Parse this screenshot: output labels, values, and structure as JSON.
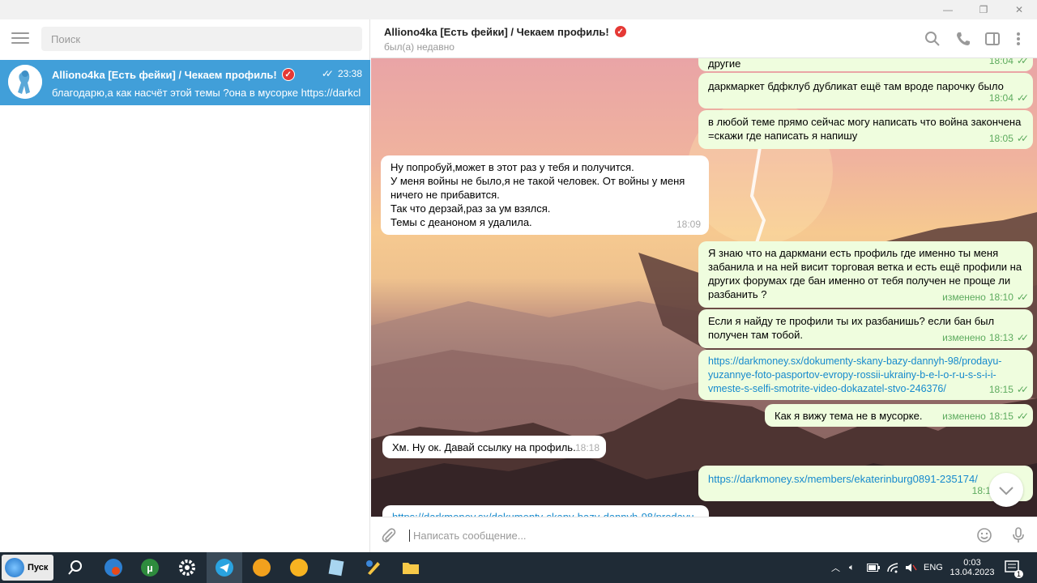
{
  "window": {
    "controls": [
      "—",
      "❐",
      "✕"
    ]
  },
  "sidebar": {
    "search_placeholder": "Поиск",
    "chat": {
      "name": "Alliono4ka [Есть фейки] / Чекаем профиль!",
      "time": "23:38",
      "preview": "благодарю,а как насчёт этой темы ?она в мусорке https://darkcl..."
    }
  },
  "header": {
    "title": "Alliono4ka [Есть фейки] / Чекаем профиль!",
    "status": "был(а) недавно"
  },
  "messages": [
    {
      "text": "другие",
      "time": "18:04",
      "edited": ""
    },
    {
      "text": "даркмаркет бдфклуб дубликат ещё там вроде парочку было",
      "time": "18:04",
      "edited": ""
    },
    {
      "text": "в любой теме прямо сейчас могу написать что война закончена\n=скажи где написать я напишу",
      "time": "18:05",
      "edited": ""
    },
    {
      "text": "Ну попробуй,может в этот раз у тебя и получится.\nУ меня войны не было,я не такой человек. От войны у меня\nничего не прибавится.\nТак что дерзай,раз за ум взялся.\nТемы с деаноном я удалила.",
      "time": "18:09",
      "edited": ""
    },
    {
      "text": "Я знаю что на даркмани есть профиль где именно ты меня\nзабанила и на ней висит торговая ветка и есть ещё профили на\nдругих форумах где бан именно от тебя получен не проще ли\nразбанить ?",
      "time": "18:10",
      "edited": "изменено"
    },
    {
      "text": "Если я найду те профили ты их разбанишь? если бан был\nполучен там тобой.",
      "time": "18:13",
      "edited": "изменено"
    },
    {
      "text": "https://darkmoney.sx/dokumenty-skany-bazy-dannyh-98/prodayu-\nyuzannye-foto-pasportov-evropy-rossii-ukrainy-b-e-l-o-r-u-s-s-i-i-\nvmeste-s-selfi-smotrite-video-dokazatel-stvo-246376/",
      "time": "18:15",
      "edited": ""
    },
    {
      "text": "Как я вижу тема не в мусорке.",
      "time": "18:15",
      "edited": "изменено"
    },
    {
      "text": "Хм. Ну ок. Давай ссылку на профиль.",
      "time": "18:18",
      "edited": ""
    },
    {
      "text": "https://darkmoney.sx/members/ekaterinburg0891-235174/",
      "time": "18:1",
      "edited": ""
    },
    {
      "text": "https://darkmoney.sx/dokumenty-skany-bazy-dannyh-98/prodayu-",
      "time": "",
      "edited": ""
    }
  ],
  "composer": {
    "placeholder": "Написать сообщение..."
  },
  "taskbar": {
    "start_label": "Пуск",
    "lang": "ENG",
    "time": "0:03",
    "date": "13.04.2023",
    "notif_count": "1"
  },
  "colors": {
    "accent": "#419fd9",
    "outgoing": "#effdde",
    "verified": "#e53935",
    "taskbar": "#1f2b36"
  }
}
